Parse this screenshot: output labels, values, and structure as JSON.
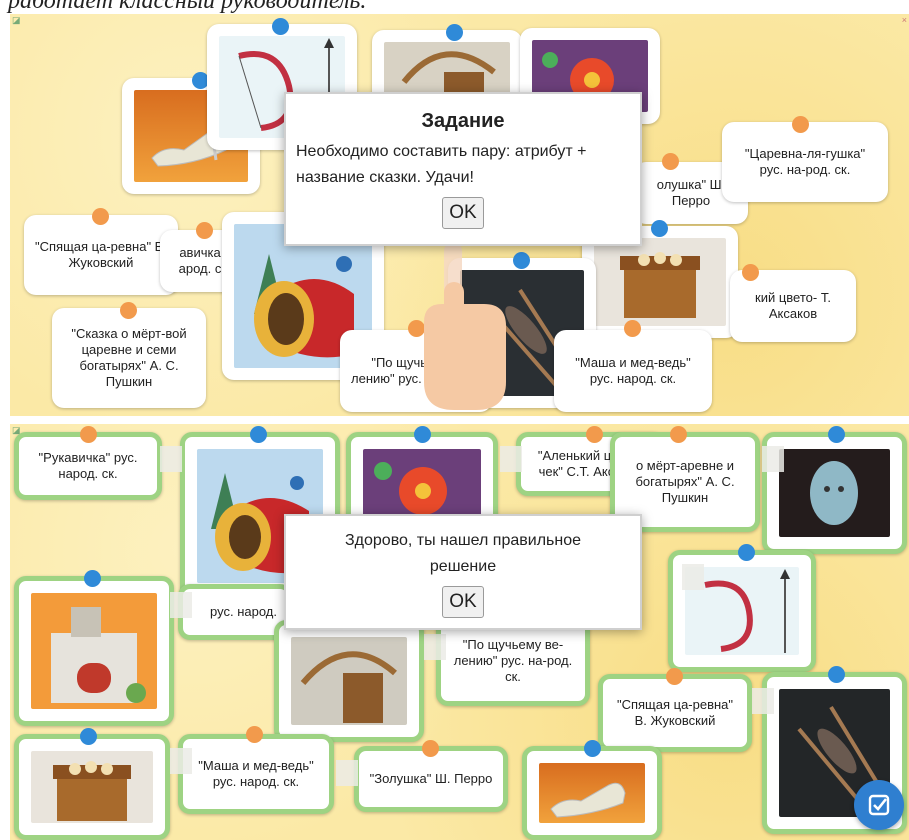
{
  "caption": "работает классный руководитель.",
  "top": {
    "cards": {
      "spyashaya": "\"Спящая ца-ревна\" В. Жуковский",
      "rukavichka_partial": "авичка\nарод. с",
      "skazka_mertvoy": "\"Сказка о мёрт-вой царевне и семи богатырях\" А. С. Пушкин",
      "zolushka_partial": "олушка\" Ш. Перро",
      "tsarevna": "\"Царевна-ля-гушка\" рус. на-род. ск.",
      "alenkiy_partial": "кий цвето- Т. Аксаков",
      "po_shchuchemu_partial": "\"По щучьему н лению\" рус. н род. ск.",
      "masha": "\"Маша и мед-ведь\" рус. народ. ск."
    },
    "dialog": {
      "title": "Задание",
      "text": "Необходимо составить пару: атрибут + название сказки. Удачи!",
      "ok": "OK"
    }
  },
  "bottom": {
    "cards": {
      "rukavichka": "\"Рукавичка\" рус. народ. ск.",
      "alenkiy": "\"Аленький цвето-чек\" С.Т. Аксаков",
      "skazka_partial": "о мёрт-аревне и богатырях\" А. С. Пушкин",
      "rus_narod_partial": "рус. народ.",
      "po_shchuchemu": "\"По щучьему ве-лению\" рус. на-род. ск.",
      "spyashaya": "\"Спящая ца-ревна\" В. Жуковский",
      "masha": "\"Маша и мед-ведь\" рус. народ. ск.",
      "zolushka": "\"Золушка\" Ш. Перро"
    },
    "dialog": {
      "text": "Здорово, ты нашел правильное решение",
      "ok": "OK"
    }
  },
  "colors": {
    "accent": "#2f7fd0",
    "matched_border": "#9ed383",
    "dot_orange": "#f29a4c",
    "dot_blue": "#2f8ad8"
  },
  "icons": {
    "check": "check-icon"
  }
}
